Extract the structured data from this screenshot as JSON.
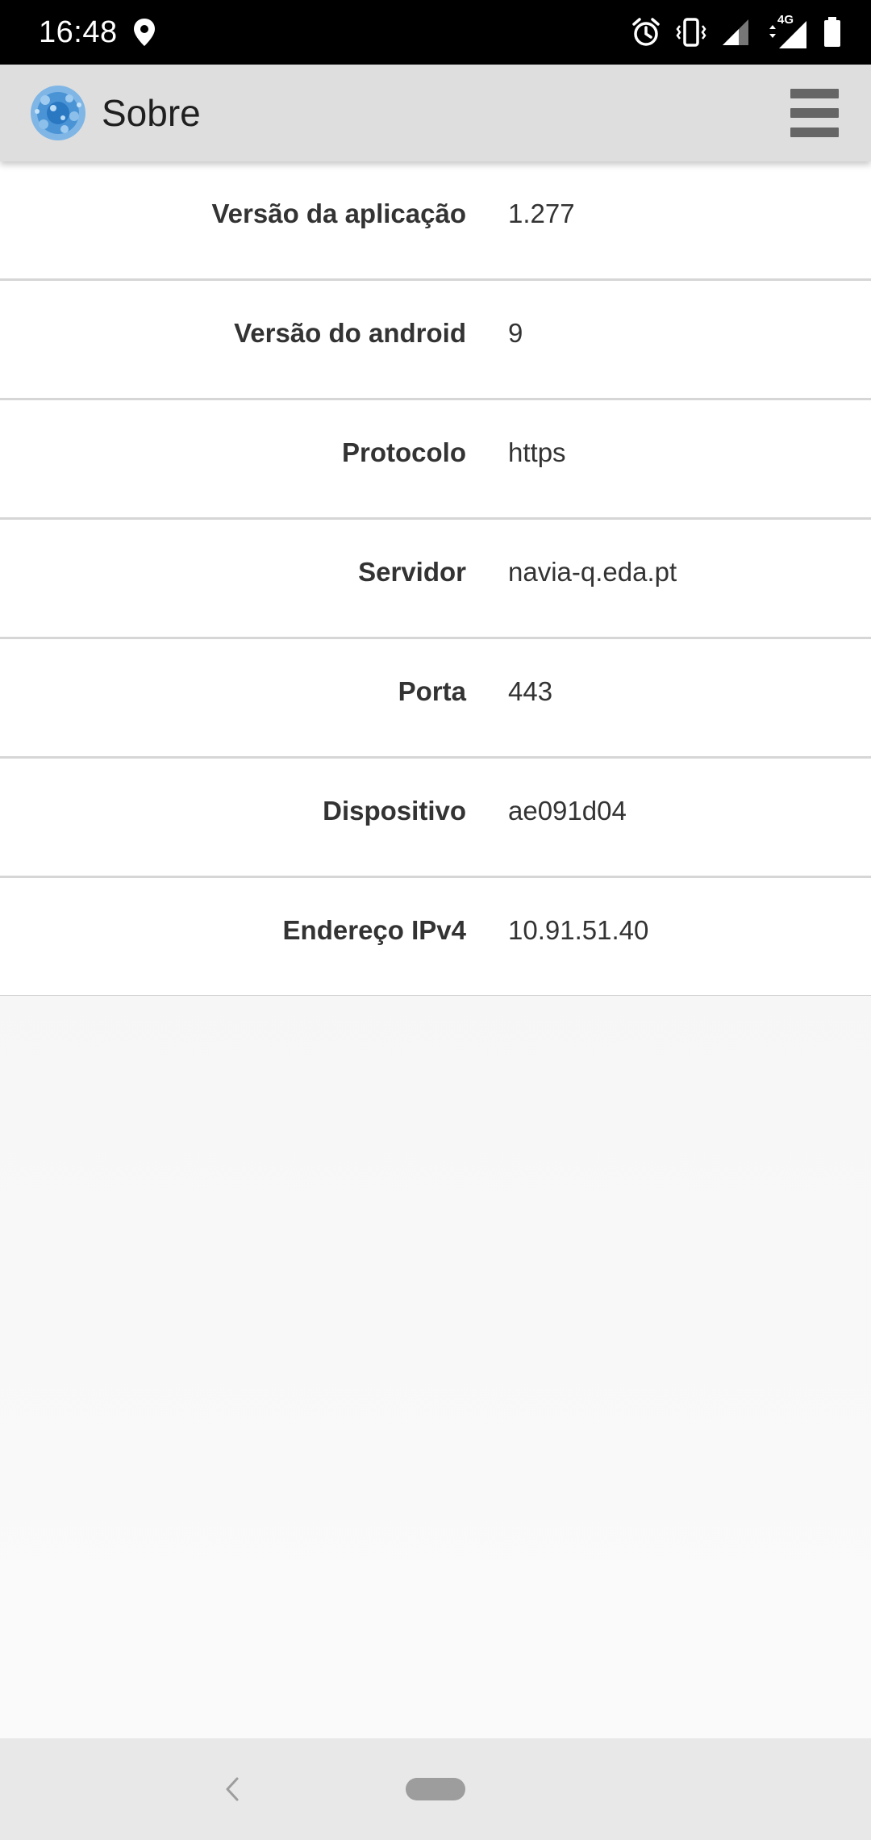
{
  "status_bar": {
    "time": "16:48",
    "network_label": "4G",
    "icons": [
      "location-icon",
      "alarm-icon",
      "vibrate-icon",
      "signal-icon",
      "network-4g-icon",
      "battery-icon"
    ]
  },
  "app_bar": {
    "title": "Sobre",
    "logo_icon": "app-logo-icon",
    "menu_icon": "hamburger-menu-icon"
  },
  "info": [
    {
      "label": "Versão da aplicação",
      "value": "1.277"
    },
    {
      "label": "Versão do android",
      "value": "9"
    },
    {
      "label": "Protocolo",
      "value": "https"
    },
    {
      "label": "Servidor",
      "value": "navia-q.eda.pt"
    },
    {
      "label": "Porta",
      "value": "443"
    },
    {
      "label": "Dispositivo",
      "value": "ae091d04"
    },
    {
      "label": "Endereço IPv4",
      "value": "10.91.51.40"
    }
  ],
  "nav_bar": {
    "icons": [
      "back-icon",
      "home-pill-icon"
    ]
  },
  "colors": {
    "status_bar_bg": "#000000",
    "app_bar_bg": "#dedede",
    "content_bg": "#ffffff",
    "divider": "#d6d6d6",
    "text": "#333333",
    "nav_bar_bg": "#e8e8e8"
  }
}
